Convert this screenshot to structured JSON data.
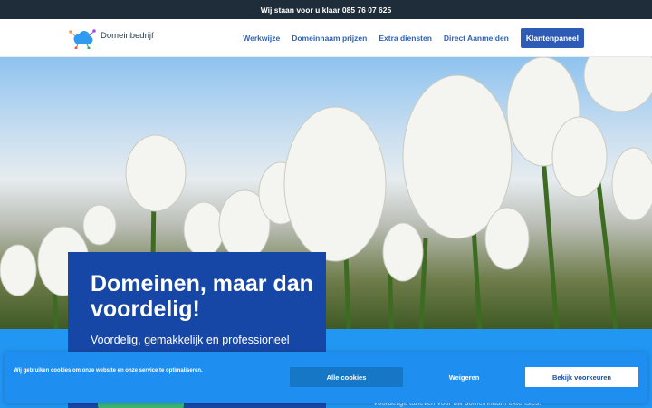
{
  "topbar": {
    "text": "Wij staan voor u klaar 085 76 07 625"
  },
  "brand": {
    "name": "Domeinbedrijf"
  },
  "nav": {
    "items": [
      "Werkwijze",
      "Domeinnaam prijzen",
      "Extra diensten",
      "Direct Aanmelden"
    ],
    "cta": "Klantenpaneel"
  },
  "hero": {
    "title": "Domeinen, maar dan voordelig!",
    "subtitle": "Voordelig, gemakkelijk en professioneel",
    "band_text": "Voordelige tarieven voor uw domeinnaam extensies."
  },
  "cookie": {
    "message": "Wij gebruiken cookies om onze website en onze service te optimaliseren.",
    "accept": "Alle cookies",
    "deny": "Weigeren",
    "preferences": "Bekijk voorkeuren"
  },
  "colors": {
    "topbar": "#1f2d3a",
    "nav_link": "#2d63b8",
    "cta": "#2d5bb5",
    "card": "#1747a6",
    "band": "#2196f3",
    "cookie_bar": "#1f8ef1"
  }
}
